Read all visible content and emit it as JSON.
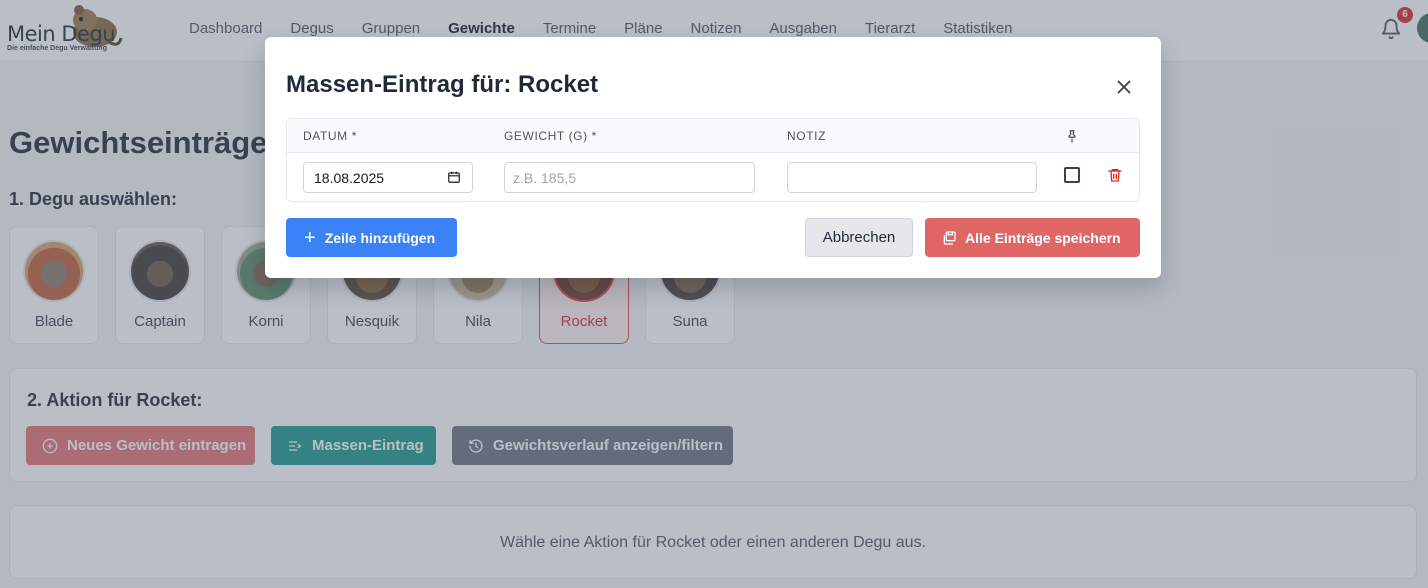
{
  "header": {
    "logo_title": "Mein Degu",
    "logo_subtitle": "Die einfache Degu Verwaltung",
    "nav": [
      "Dashboard",
      "Degus",
      "Gruppen",
      "Gewichte",
      "Termine",
      "Pläne",
      "Notizen",
      "Ausgaben",
      "Tierarzt",
      "Statistiken"
    ],
    "active_nav": "Gewichte",
    "notification_count": "6"
  },
  "page": {
    "title": "Gewichtseinträge",
    "step1_label": "1. Degu auswählen:",
    "degus": [
      {
        "name": "Blade",
        "selected": false
      },
      {
        "name": "Captain",
        "selected": false
      },
      {
        "name": "Korni",
        "selected": false
      },
      {
        "name": "Nesquik",
        "selected": false
      },
      {
        "name": "Nila",
        "selected": false
      },
      {
        "name": "Rocket",
        "selected": true
      },
      {
        "name": "Suna",
        "selected": false
      }
    ],
    "step2_label": "2. Aktion für Rocket:",
    "actions": {
      "new_weight": "Neues Gewicht eintragen",
      "bulk_entry": "Massen-Eintrag",
      "history": "Gewichtsverlauf anzeigen/filtern"
    },
    "info_text": "Wähle eine Aktion für Rocket oder einen anderen Degu aus."
  },
  "modal": {
    "title": "Massen-Eintrag für: Rocket",
    "columns": {
      "date": "DATUM *",
      "weight": "GEWICHT (G) *",
      "note": "NOTIZ"
    },
    "row": {
      "date_value": "18.08.2025",
      "weight_value": "",
      "weight_placeholder": "z.B. 185,5",
      "note_value": "",
      "pinned": false
    },
    "add_row_label": "Zeile hinzufügen",
    "cancel_label": "Abbrechen",
    "save_all_label": "Alle Einträge speichern"
  },
  "colors": {
    "primary_blue": "#3b82f6",
    "save_red": "#e06666",
    "teal": "#199a8a",
    "danger": "#dc2626"
  }
}
